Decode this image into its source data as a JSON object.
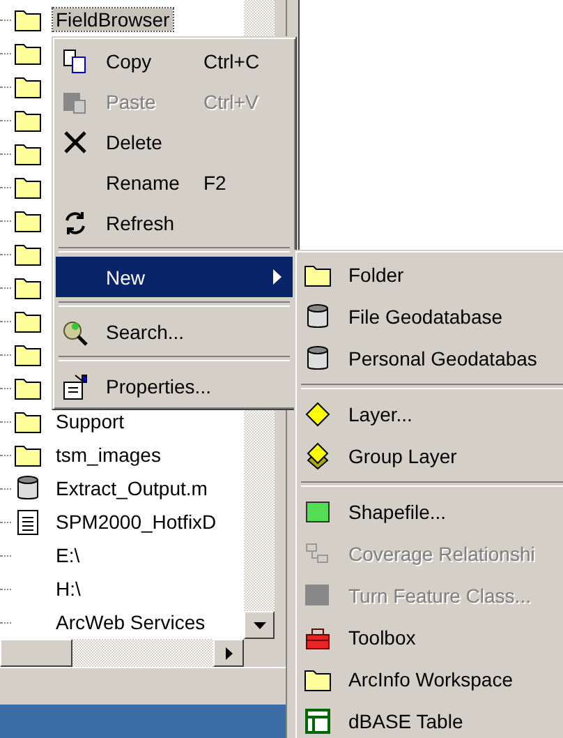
{
  "tree": {
    "items": [
      {
        "kind": "folder",
        "label": "FieldBrowser",
        "selected": true
      },
      {
        "kind": "folder"
      },
      {
        "kind": "folder"
      },
      {
        "kind": "folder"
      },
      {
        "kind": "folder"
      },
      {
        "kind": "folder"
      },
      {
        "kind": "folder"
      },
      {
        "kind": "folder"
      },
      {
        "kind": "folder"
      },
      {
        "kind": "folder"
      },
      {
        "kind": "folder"
      },
      {
        "kind": "folder"
      },
      {
        "kind": "folder",
        "label": "Support",
        "selected": false
      },
      {
        "kind": "folder",
        "label": "tsm_images",
        "selected": false
      },
      {
        "kind": "database",
        "label": "Extract_Output.m",
        "selected": false
      },
      {
        "kind": "document",
        "label": "SPM2000_HotfixD",
        "selected": false
      },
      {
        "kind": "drive",
        "label": "E:\\",
        "selected": false
      },
      {
        "kind": "drive",
        "label": "H:\\",
        "selected": false
      },
      {
        "kind": "service",
        "label": "ArcWeb Services",
        "selected": false
      }
    ]
  },
  "context_menu": {
    "items": [
      {
        "kind": "copy",
        "label": "Copy",
        "shortcut": "Ctrl+C",
        "disabled": false,
        "selected": false
      },
      {
        "kind": "paste",
        "label": "Paste",
        "shortcut": "Ctrl+V",
        "disabled": true,
        "selected": false
      },
      {
        "kind": "delete",
        "label": "Delete",
        "disabled": false,
        "selected": false
      },
      {
        "kind": "plain",
        "label": "Rename",
        "shortcut": "F2",
        "disabled": false,
        "selected": false
      },
      {
        "kind": "refresh",
        "label": "Refresh",
        "disabled": false,
        "selected": false
      },
      {
        "kind": "separator"
      },
      {
        "kind": "submenu",
        "label": "New",
        "disabled": false,
        "selected": true
      },
      {
        "kind": "separator"
      },
      {
        "kind": "search",
        "label": "Search...",
        "disabled": false,
        "selected": false
      },
      {
        "kind": "separator"
      },
      {
        "kind": "properties",
        "label": "Properties...",
        "disabled": false,
        "selected": false
      }
    ]
  },
  "submenu": {
    "items": [
      {
        "kind": "folder",
        "label": "Folder",
        "disabled": false
      },
      {
        "kind": "database",
        "label": "File Geodatabase",
        "disabled": false
      },
      {
        "kind": "database",
        "label": "Personal Geodatabas",
        "disabled": false
      },
      {
        "kind": "separator"
      },
      {
        "kind": "layer",
        "label": "Layer...",
        "disabled": false
      },
      {
        "kind": "grouplayer",
        "label": "Group Layer",
        "disabled": false
      },
      {
        "kind": "separator"
      },
      {
        "kind": "shapefile",
        "label": "Shapefile...",
        "disabled": false
      },
      {
        "kind": "relationship",
        "label": "Coverage Relationshi",
        "disabled": true
      },
      {
        "kind": "featureclass",
        "label": "Turn Feature Class...",
        "disabled": true
      },
      {
        "kind": "toolbox",
        "label": "Toolbox",
        "disabled": false
      },
      {
        "kind": "folder",
        "label": "ArcInfo Workspace",
        "disabled": false
      },
      {
        "kind": "table",
        "label": "dBASE Table",
        "disabled": false
      }
    ]
  }
}
